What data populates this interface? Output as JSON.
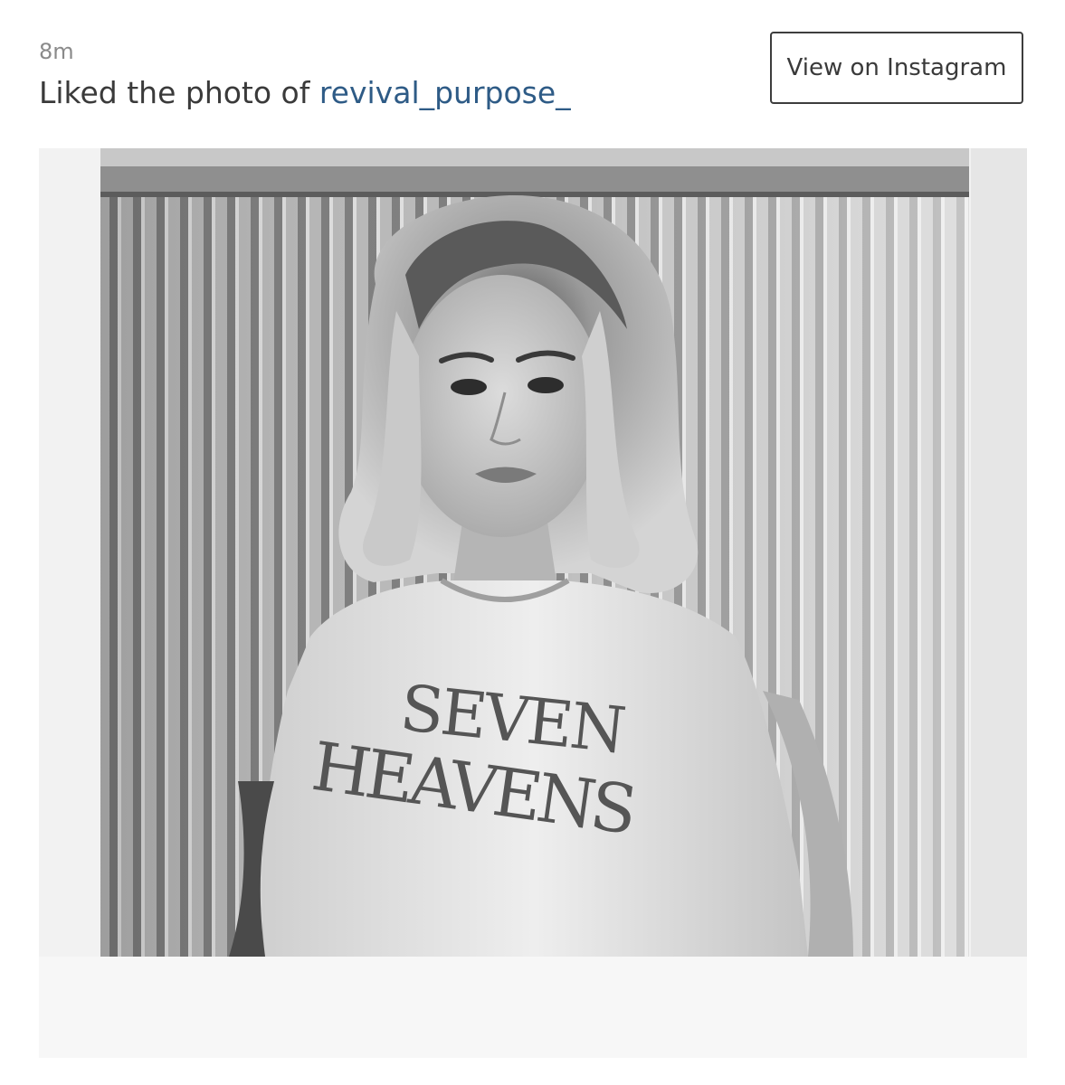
{
  "activity": {
    "time_ago": "8m",
    "action_prefix": "Liked the photo of ",
    "username": "revival_purpose_"
  },
  "actions": {
    "view_label": "View on Instagram"
  },
  "photo": {
    "shirt_line1": "SEVEN",
    "shirt_line2": "HEAVENS"
  },
  "colors": {
    "username_link": "#2e5b86",
    "text_primary": "#3a3a3a",
    "text_muted": "#8a8a8a",
    "button_border": "#3d3d3d"
  }
}
